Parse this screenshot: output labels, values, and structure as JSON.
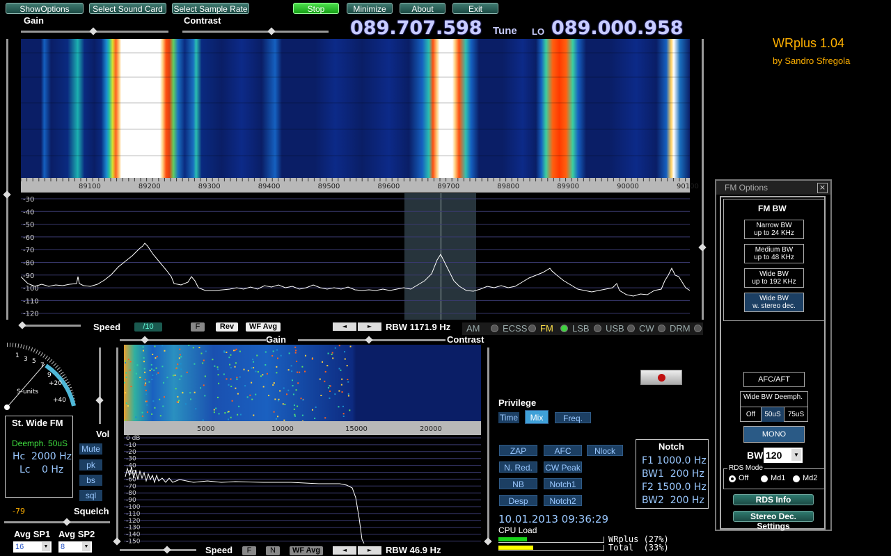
{
  "toolbar": {
    "show_options": "ShowOptions",
    "select_sound_card": "Select Sound Card",
    "select_sample_rate": "Select Sample Rate",
    "stop": "Stop",
    "minimize": "Minimize",
    "about": "About",
    "exit": "Exit"
  },
  "top_controls": {
    "gain": "Gain",
    "contrast": "Contrast"
  },
  "tuning": {
    "tune_freq": "089.707.598",
    "tune_label": "Tune",
    "lo_label": "LO",
    "lo_freq": "089.000.958"
  },
  "app": {
    "name": "WRplus 1.04",
    "author": "by Sandro Sfregola"
  },
  "rf_axis": {
    "x_ticks": [
      "89100",
      "89200",
      "89300",
      "89400",
      "89500",
      "89600",
      "89700",
      "89800",
      "89900",
      "90000",
      "90100"
    ],
    "y_ticks": [
      "-30",
      "-40",
      "-50",
      "-60",
      "-70",
      "-80",
      "-90",
      "-100",
      "-110",
      "-120"
    ]
  },
  "speed": {
    "label": "Speed",
    "value": "/10",
    "f": "F",
    "rev": "Rev",
    "wf_avg": "WF Avg"
  },
  "rbw_top": "RBW 1171.9 Hz",
  "modes": [
    {
      "label": "AM",
      "on": false
    },
    {
      "label": "ECSS",
      "on": false
    },
    {
      "label": "FM",
      "on": true
    },
    {
      "label": "LSB",
      "on": false
    },
    {
      "label": "USB",
      "on": false
    },
    {
      "label": "CW",
      "on": false
    },
    {
      "label": "DRM",
      "on": false
    }
  ],
  "audio": {
    "gain": "Gain",
    "contrast": "Contrast",
    "x_ticks": [
      "5000",
      "10000",
      "15000",
      "20000"
    ],
    "y_ticks": [
      "0 dB",
      "-10",
      "-20",
      "-30",
      "-40",
      "-50",
      "-60",
      "-70",
      "-80",
      "-90",
      "-100",
      "-110",
      "-120",
      "-130",
      "-140",
      "-150"
    ],
    "speed": "Speed",
    "f": "F",
    "n": "N",
    "wf_avg": "WF Avg",
    "rbw": "RBW 46.9 Hz"
  },
  "smeter": {
    "scale": [
      "1",
      "3",
      "5",
      "7",
      "9",
      "+20",
      "+40"
    ],
    "units": "S-units"
  },
  "station": {
    "mode": "St. Wide FM",
    "deemph": "Deemph. 50uS",
    "hc_label": "Hc",
    "hc_value": "2000 Hz",
    "lc_label": "Lc",
    "lc_value": "0 Hz"
  },
  "vol": {
    "label": "Vol",
    "mute": "Mute",
    "pk": "pk",
    "bs": "bs",
    "sql": "sql"
  },
  "squelch": {
    "level": "-79",
    "label": "Squelch"
  },
  "avg": {
    "sp1_label": "Avg SP1",
    "sp2_label": "Avg SP2",
    "sp1_value": "16",
    "sp2_value": "8"
  },
  "privilege": {
    "label": "Privilege",
    "time": "Time",
    "mix": "Mix",
    "freq": "Freq."
  },
  "dsp": {
    "zap": "ZAP",
    "afc": "AFC",
    "nlock": "Nlock",
    "nred": "N. Red.",
    "cw_peak": "CW Peak",
    "nb": "NB",
    "notch1": "Notch1",
    "desp": "Desp",
    "notch2": "Notch2"
  },
  "notch": {
    "title": "Notch",
    "f1": "F1 1000.0 Hz",
    "bw1": "BW1  200 Hz",
    "f2": "F2 1500.0 Hz",
    "bw2": "BW2  200 Hz"
  },
  "datetime": "10.01.2013 09:36:29",
  "cpu": {
    "title": "CPU Load",
    "wrplus": "WRplus (27%)",
    "total": "Total  (33%)",
    "wrplus_level": 0.27,
    "total_level": 0.33
  },
  "fm_options": {
    "title": "FM Options",
    "close": "×",
    "bw_heading": "FM BW",
    "narrow_1": "Narrow BW",
    "narrow_2": "up to 24 KHz",
    "medium_1": "Medium BW",
    "medium_2": "up to 48 KHz",
    "wide_1": "Wide BW",
    "wide_2": "up to 192 KHz",
    "wst_1": "Wide BW",
    "wst_2": "w. stereo dec.",
    "afc_aft": "AFC/AFT",
    "deemph_title": "Wide BW Deemph.",
    "deemph_off": "Off",
    "deemph_50": "50uS",
    "deemph_75": "75uS",
    "mono": "MONO",
    "bw_label": "BW",
    "bw_value": "120",
    "rds_mode": "RDS Mode",
    "rds_off": "Off",
    "rds_md1": "Md1",
    "rds_md2": "Md2",
    "rds_info": "RDS Info",
    "stereo_settings": "Stereo Dec. Settings"
  },
  "colors": {
    "accent_orange": "#ffb000",
    "freq_display": "#c8ccff",
    "cpu_bar_green": "#19d619",
    "cpu_bar_yellow": "#ffff00"
  }
}
